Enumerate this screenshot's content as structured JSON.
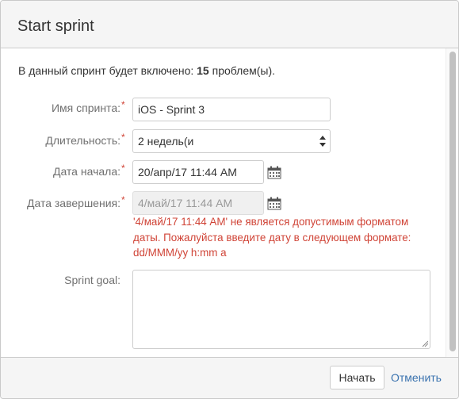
{
  "dialog": {
    "title": "Start sprint"
  },
  "intro": {
    "prefix": "В данный спринт будет включено: ",
    "count": "15",
    "suffix": " проблем(ы)."
  },
  "form": {
    "sprint_name": {
      "label": "Имя спринта:",
      "required": "*",
      "value": "iOS - Sprint 3"
    },
    "duration": {
      "label": "Длительность:",
      "required": "*",
      "value": "2 недель(и"
    },
    "start_date": {
      "label": "Дата начала:",
      "required": "*",
      "value": "20/апр/17 11:44 AM",
      "icon": "calendar-icon"
    },
    "end_date": {
      "label": "Дата завершения:",
      "required": "*",
      "value": "4/май/17 11:44 AM",
      "icon": "calendar-icon"
    },
    "error": "'4/май/17 11:44 AM' не является допустимым форматом даты. Пожалуйста введите дату в следующем формате: dd/MMM/yy h:mm a",
    "goal": {
      "label": "Sprint goal:",
      "value": ""
    }
  },
  "footer": {
    "start_label": "Начать",
    "cancel_label": "Отменить"
  },
  "colors": {
    "error": "#d04437",
    "link": "#3b73af",
    "header_bg": "#f5f5f5"
  }
}
